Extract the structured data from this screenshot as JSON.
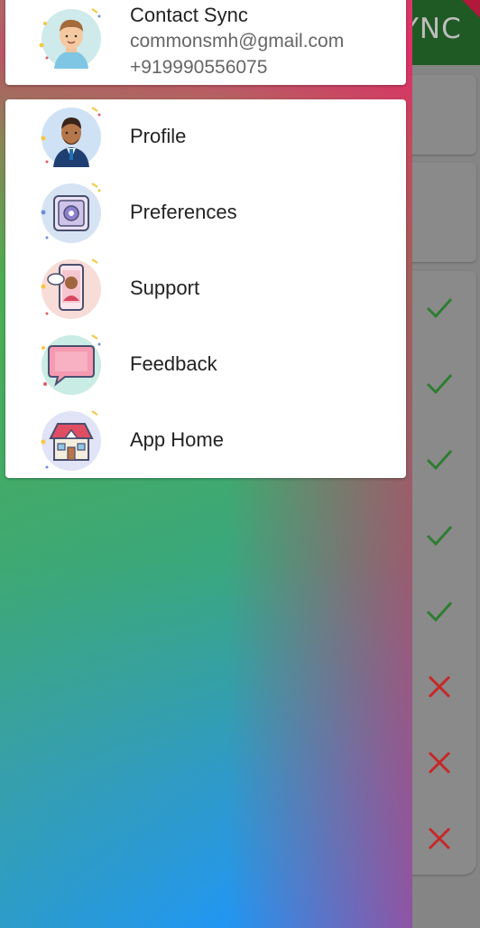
{
  "background_app": {
    "appbar_title_fragment": "YNC",
    "status_marks": [
      "check",
      "check",
      "check",
      "check",
      "check",
      "cross",
      "cross",
      "cross"
    ],
    "colors": {
      "check": "#2e7d32",
      "cross": "#c62828",
      "appbar": "#1f5a24"
    }
  },
  "drawer": {
    "gradient_colors": [
      "#4caf50",
      "#e91e63",
      "#2196f3"
    ],
    "header": {
      "app_name": "Contact Sync",
      "email": "commonsmh@gmail.com",
      "phone": "+919990556075",
      "avatar_icon": "user-avatar-icon"
    },
    "menu_items": [
      {
        "label": "Profile",
        "icon": "profile-icon"
      },
      {
        "label": "Preferences",
        "icon": "preferences-icon"
      },
      {
        "label": "Support",
        "icon": "support-icon"
      },
      {
        "label": "Feedback",
        "icon": "feedback-icon"
      },
      {
        "label": "App Home",
        "icon": "home-icon"
      }
    ]
  }
}
